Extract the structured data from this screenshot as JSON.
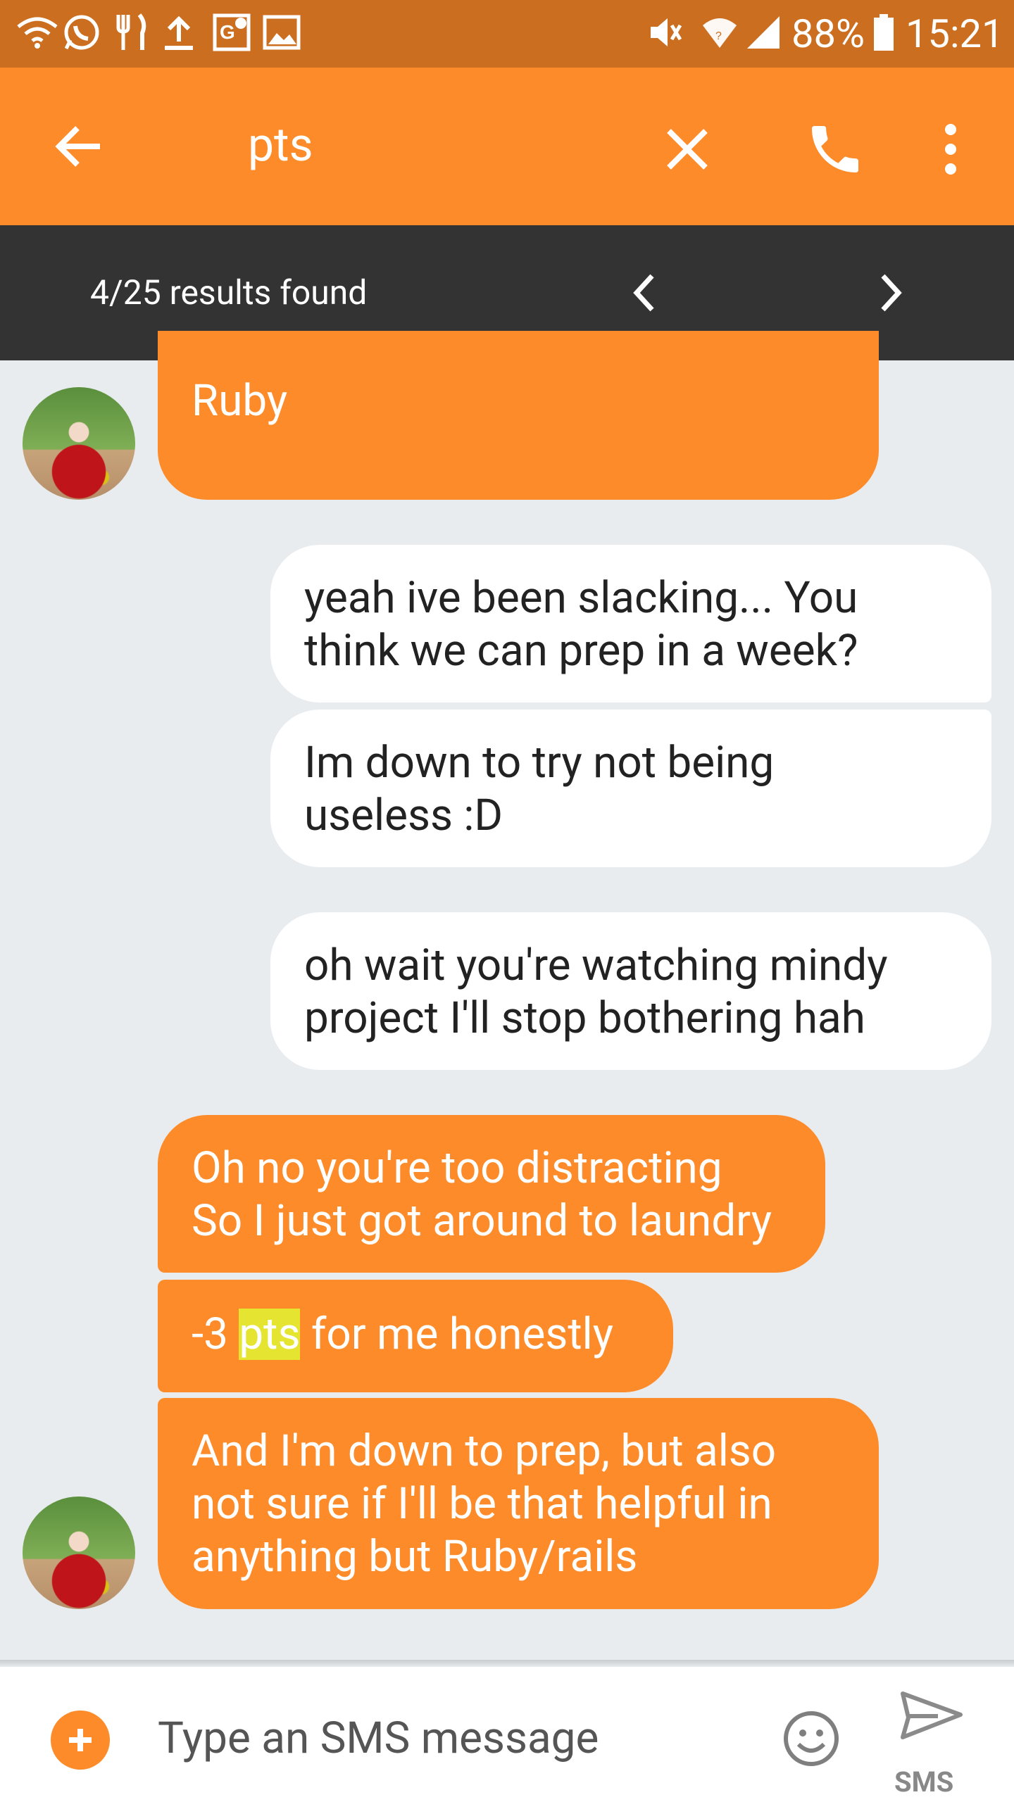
{
  "status_bar": {
    "battery": "88%",
    "time": "15:21",
    "icons": [
      "wifi-call-icon",
      "whatsapp-icon",
      "restaurant-icon",
      "upload-icon",
      "maps-icon",
      "image-icon",
      "mute-icon",
      "wifi-icon",
      "signal-icon",
      "battery-icon"
    ]
  },
  "app_bar": {
    "search_query": "pts",
    "icons": [
      "back-arrow-icon",
      "close-icon",
      "phone-icon",
      "more-vert-icon"
    ]
  },
  "search_results": {
    "text": "4/25 results found",
    "icons": [
      "chevron-left-icon",
      "chevron-right-icon"
    ]
  },
  "messages": [
    {
      "direction": "in",
      "lines": [
        "Ruby"
      ]
    },
    {
      "direction": "out",
      "lines": [
        "yeah ive been slacking... You",
        "think we can prep in a week?"
      ]
    },
    {
      "direction": "out",
      "lines": [
        "Im down to try not being",
        "useless :D"
      ]
    },
    {
      "direction": "out",
      "lines": [
        "oh wait you're watching mindy",
        "project I'll stop bothering hah"
      ]
    },
    {
      "direction": "in",
      "lines": [
        "Oh no you're too distracting",
        "So I just got around to laundry"
      ]
    },
    {
      "direction": "in",
      "before": "-3 ",
      "match": "pts",
      "after": " for me honestly"
    },
    {
      "direction": "in",
      "lines": [
        "And I'm down to prep, but also",
        "not sure if I'll be that helpful in",
        "anything but Ruby/rails"
      ]
    }
  ],
  "input": {
    "placeholder": "Type an SMS message",
    "send_label": "SMS",
    "icons": [
      "add-icon",
      "emoji-icon",
      "send-icon"
    ]
  },
  "colors": {
    "status_bar": "#cb6e1f",
    "app_bar": "#fd8b29",
    "search_bar": "#333333",
    "background": "#e9ecef",
    "incoming_bubble": "#fd8b29",
    "outgoing_bubble": "#ffffff",
    "highlight": "#e4e431"
  }
}
